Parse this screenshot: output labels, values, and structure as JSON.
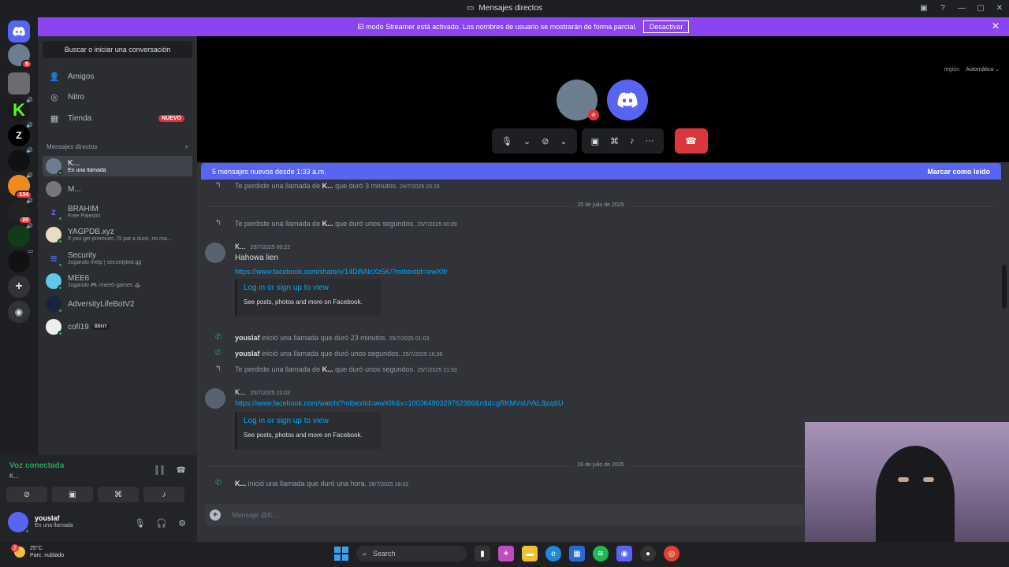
{
  "window": {
    "title": "Mensajes directos"
  },
  "streamer": {
    "text": "El modo Streamer está activado. Los nombres de usuario se mostrarán de forma parcial.",
    "button": "Desactivar"
  },
  "guilds": [
    {
      "label": "",
      "badge": "5"
    },
    {
      "label": "",
      "badge": ""
    },
    {
      "label": "K",
      "badge": ""
    },
    {
      "label": "Z",
      "badge": ""
    },
    {
      "label": "",
      "badge": ""
    },
    {
      "label": "",
      "badge": "134"
    },
    {
      "label": "",
      "badge": "20"
    },
    {
      "label": "",
      "badge": ""
    },
    {
      "label": "",
      "badge": ""
    }
  ],
  "search": {
    "label": "Buscar o iniciar una conversación"
  },
  "nav": {
    "friends": "Amigos",
    "nitro": "Nitro",
    "shop": "Tienda",
    "new_badge": "NUEVO"
  },
  "dm_header": {
    "title": "Mensajes directos",
    "add": "+"
  },
  "dms": [
    {
      "name": "K...",
      "sub": "En una llamada"
    },
    {
      "name": "M...",
      "sub": ""
    },
    {
      "name": "BRAHIM",
      "sub": "Free Palestin"
    },
    {
      "name": "YAGPDB.xyz",
      "sub": "If you get premium, I'll pat a duck, no ma..."
    },
    {
      "name": "Security",
      "sub": "Jugando /help | securitybot.gg"
    },
    {
      "name": "MEE6",
      "sub": "Jugando 🎮 /mee6-games 🕹️"
    },
    {
      "name": "AdversityLifeBotV2",
      "sub": ""
    },
    {
      "name": "cofi19",
      "sub": "",
      "tag": "BBNY"
    }
  ],
  "voice": {
    "status": "Voz conectada",
    "channel": "K..."
  },
  "user": {
    "name": "youslaf",
    "status": "En una llamada"
  },
  "call": {
    "region_label": "región",
    "region_value": "Automática"
  },
  "new_messages": {
    "text": "5 mensajes nuevos desde 1:33 a.m.",
    "mark_read": "Marcar como leído"
  },
  "messages": {
    "sys1": {
      "pre": "Te perdiste una llamada de ",
      "who": "K...",
      "post": " que duró 3 minutos.",
      "ts": "24/7/2025 23:15"
    },
    "date1": "25 de julio de 2025",
    "sys2": {
      "pre": "Te perdiste una llamada de ",
      "who": "K...",
      "post": " que duró unos segundos.",
      "ts": "25/7/2025 00:09"
    },
    "msg1": {
      "author": "K...",
      "ts": "25/7/2025 00:22",
      "text": "Hahowa lien",
      "link": "https://www.facebook.com/share/v/14DiNNcXz5K/?mibextid=wwXIfr",
      "embed_title": "Log in or sign up to view",
      "embed_desc": "See posts, photos and more on Facebook."
    },
    "sys3": {
      "who": "youslaf",
      "post": " inició una llamada que duró 23 minutos.",
      "ts": "25/7/2025 01:03"
    },
    "sys4": {
      "who": "youslaf",
      "post": " inició una llamada que duró unos segundos.",
      "ts": "25/7/2025 16:36"
    },
    "sys5": {
      "pre": "Te perdiste una llamada de ",
      "who": "K...",
      "post": " que duró unos segundos.",
      "ts": "25/7/2025 21:53"
    },
    "msg2": {
      "author": "K...",
      "ts": "25/7/2025 22:02",
      "link": "https://www.facebook.com/watch/?mibextid=wwXIfr&v=1003649032976238​6&rdid=gRKMVsUVkL3jcq6U",
      "embed_title": "Log in or sign up to view",
      "embed_desc": "See posts, photos and more on Facebook."
    },
    "date2": "26 de julio de 2025",
    "sys6": {
      "who": "K...",
      "post": " inició una llamada que duró una hora.",
      "ts": "26/7/2025 18:02"
    }
  },
  "composer": {
    "placeholder": "Mensaje @K..."
  },
  "taskbar": {
    "temp": "25°C",
    "weather": "Parc. nublado",
    "weather_badge": "2",
    "search": "Search"
  }
}
